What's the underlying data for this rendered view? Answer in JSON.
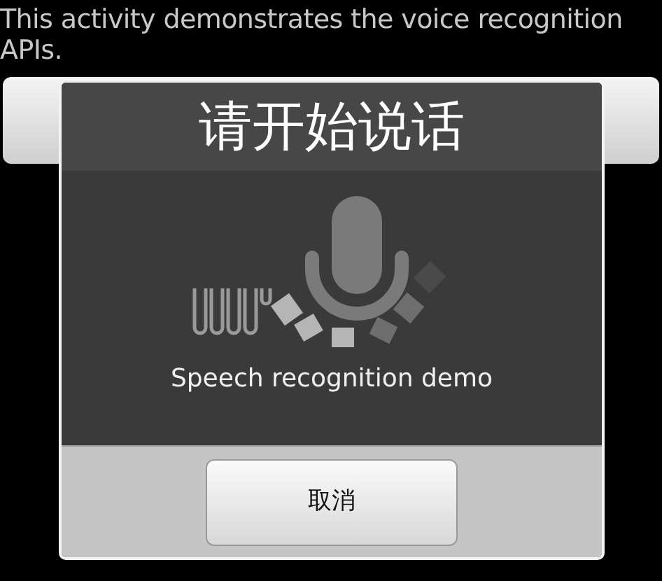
{
  "activity": {
    "description": "This activity demonstrates the voice recognition APIs."
  },
  "dialog": {
    "title": "请开始说话",
    "prompt": "Speech recognition demo",
    "buttons": [
      {
        "label": "取消"
      }
    ]
  }
}
